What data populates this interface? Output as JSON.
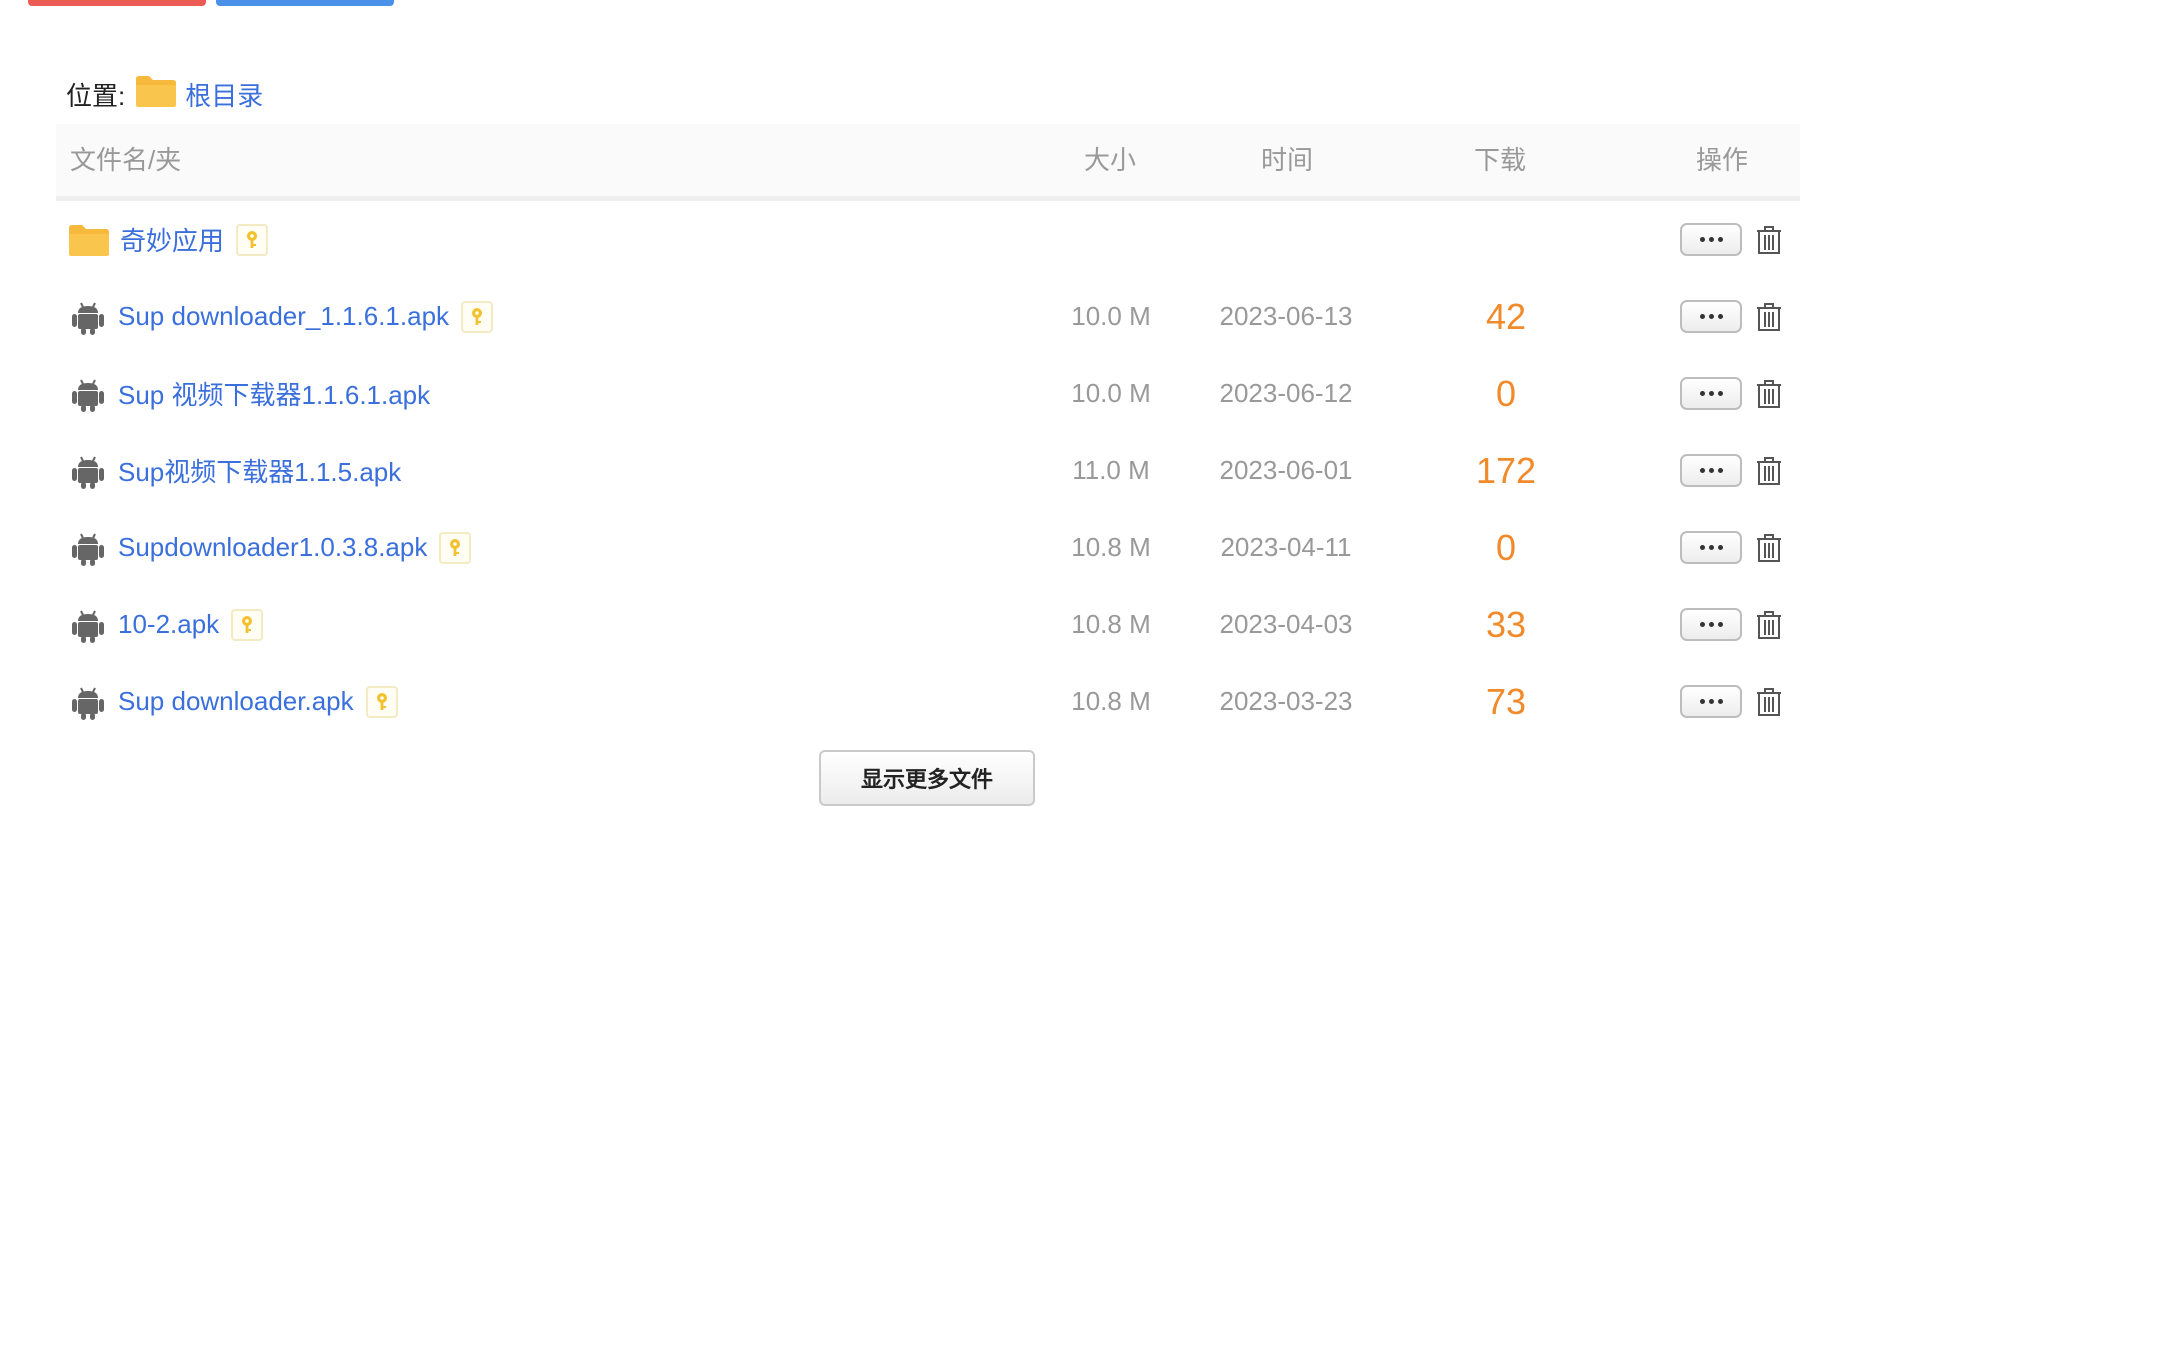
{
  "location": {
    "label": "位置:",
    "root": "根目录"
  },
  "table": {
    "headers": {
      "name": "文件名/夹",
      "size": "大小",
      "time": "时间",
      "downloads": "下载",
      "ops": "操作"
    },
    "rows": [
      {
        "type": "folder",
        "name": "奇妙应用",
        "locked": true,
        "size": "",
        "time": "",
        "downloads": ""
      },
      {
        "type": "apk",
        "name": "Sup downloader_1.1.6.1.apk",
        "locked": true,
        "size": "10.0 M",
        "time": "2023-06-13",
        "downloads": "42"
      },
      {
        "type": "apk",
        "name": "Sup 视频下载器1.1.6.1.apk",
        "locked": false,
        "size": "10.0 M",
        "time": "2023-06-12",
        "downloads": "0"
      },
      {
        "type": "apk",
        "name": "Sup视频下载器1.1.5.apk",
        "locked": false,
        "size": "11.0 M",
        "time": "2023-06-01",
        "downloads": "172"
      },
      {
        "type": "apk",
        "name": "Supdownloader1.0.3.8.apk",
        "locked": true,
        "size": "10.8 M",
        "time": "2023-04-11",
        "downloads": "0"
      },
      {
        "type": "apk",
        "name": "10-2.apk",
        "locked": true,
        "size": "10.8 M",
        "time": "2023-04-03",
        "downloads": "33"
      },
      {
        "type": "apk",
        "name": "Sup downloader.apk",
        "locked": true,
        "size": "10.8 M",
        "time": "2023-03-23",
        "downloads": "73"
      }
    ]
  },
  "show_more_label": "显示更多文件",
  "colors": {
    "link": "#3a6fdc",
    "download_count": "#f08a2a",
    "folder": "#f6b93b",
    "top_red": "#e95b53",
    "top_blue": "#4a90e8"
  }
}
